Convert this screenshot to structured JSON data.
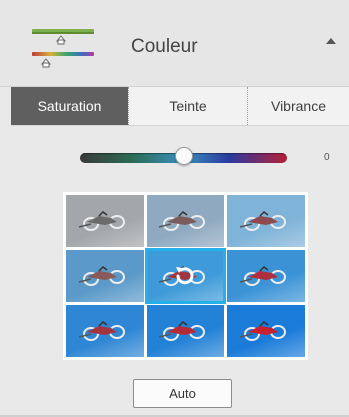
{
  "header": {
    "title": "Couleur",
    "icon": "color-sliders-icon",
    "collapse_icon": "collapse-arrow-icon"
  },
  "tabs": [
    {
      "label": "Saturation",
      "active": true
    },
    {
      "label": "Teinte",
      "active": false
    },
    {
      "label": "Vibrance",
      "active": false
    }
  ],
  "slider": {
    "value_label": "0",
    "position": 0.5,
    "colors": [
      "#3a3a3a",
      "#2a6c53",
      "#3a8fbf",
      "#2b3aa0",
      "#b52035"
    ]
  },
  "variations": [
    {
      "bg": "#a3a6aa",
      "bike": "#6b6b6b",
      "selected": false
    },
    {
      "bg": "#8fa9c0",
      "bike": "#7a5c5c",
      "selected": false
    },
    {
      "bg": "#7fb3d8",
      "bike": "#8e4a4f",
      "selected": false
    },
    {
      "bg": "#5a99c9",
      "bike": "#8a5a5a",
      "selected": false
    },
    {
      "bg": "#3e9ad8",
      "bike": "#a0363f",
      "selected": true
    },
    {
      "bg": "#3b93d6",
      "bike": "#b02f3c",
      "selected": false
    },
    {
      "bg": "#2f86d4",
      "bike": "#a33540",
      "selected": false
    },
    {
      "bg": "#2482d6",
      "bike": "#b52a37",
      "selected": false
    },
    {
      "bg": "#1a7bd9",
      "bike": "#c8202e",
      "selected": false
    }
  ],
  "auto_button": {
    "label": "Auto"
  }
}
